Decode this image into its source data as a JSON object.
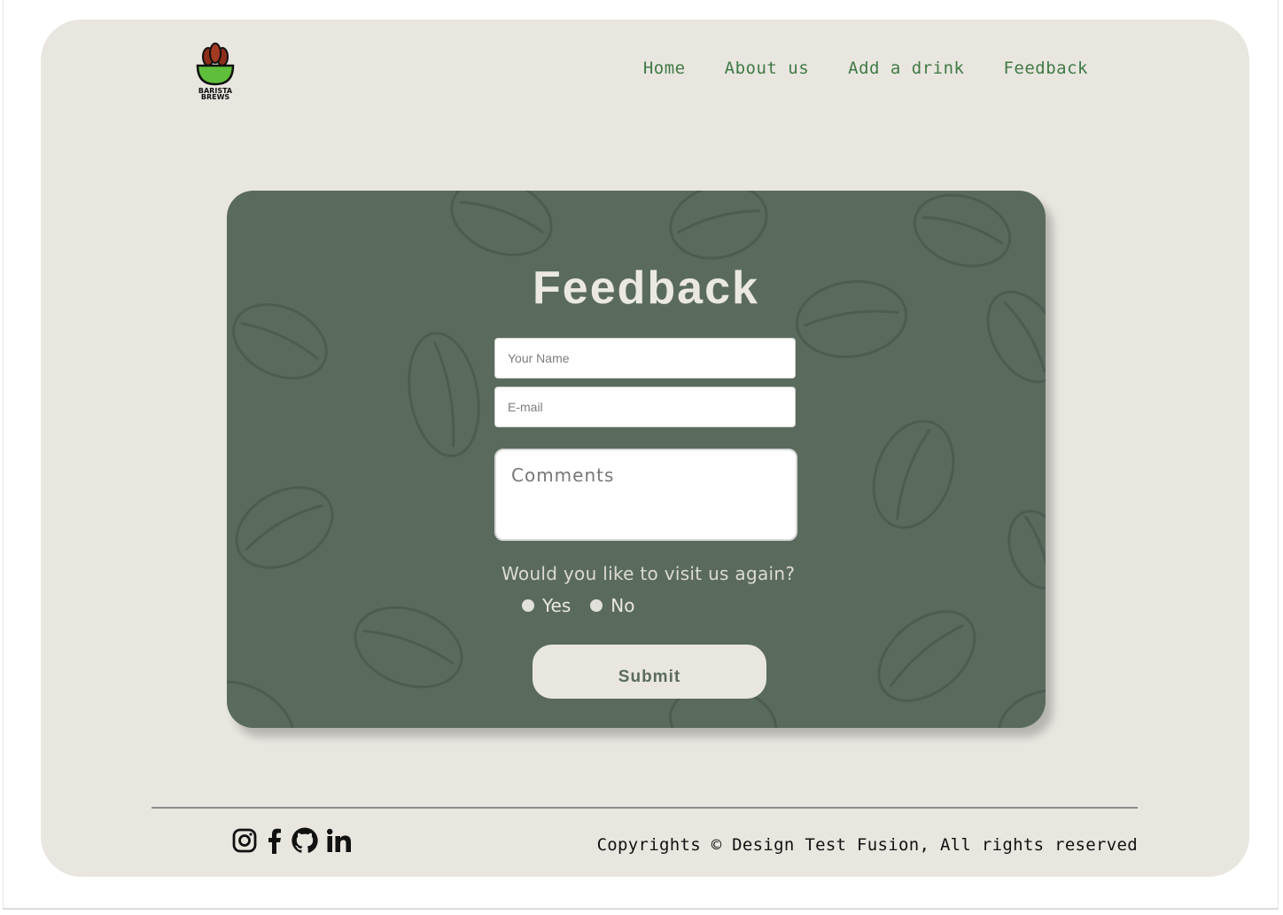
{
  "header": {
    "logo_text": [
      "BARISTA",
      "BREWS"
    ],
    "nav": [
      "Home",
      "About us",
      "Add a drink",
      "Feedback"
    ]
  },
  "form": {
    "title": "Feedback",
    "name_placeholder": "Your Name",
    "email_placeholder": "E-mail",
    "comments_placeholder": "Comments",
    "question": "Would you like to visit us again?",
    "options": [
      "Yes",
      "No"
    ],
    "submit_label": "Submit"
  },
  "footer": {
    "social_icons": [
      "instagram-icon",
      "facebook-icon",
      "github-icon",
      "linkedin-icon"
    ],
    "copyright": "Copyrights © Design Test Fusion, All rights reserved"
  },
  "colors": {
    "page_bg": "#e9e6e0",
    "card_bg": "#5a6b5e",
    "nav_link": "#3f7a45",
    "logo_cup": "#5fbf3a",
    "logo_beans": "#8b2e1a"
  }
}
